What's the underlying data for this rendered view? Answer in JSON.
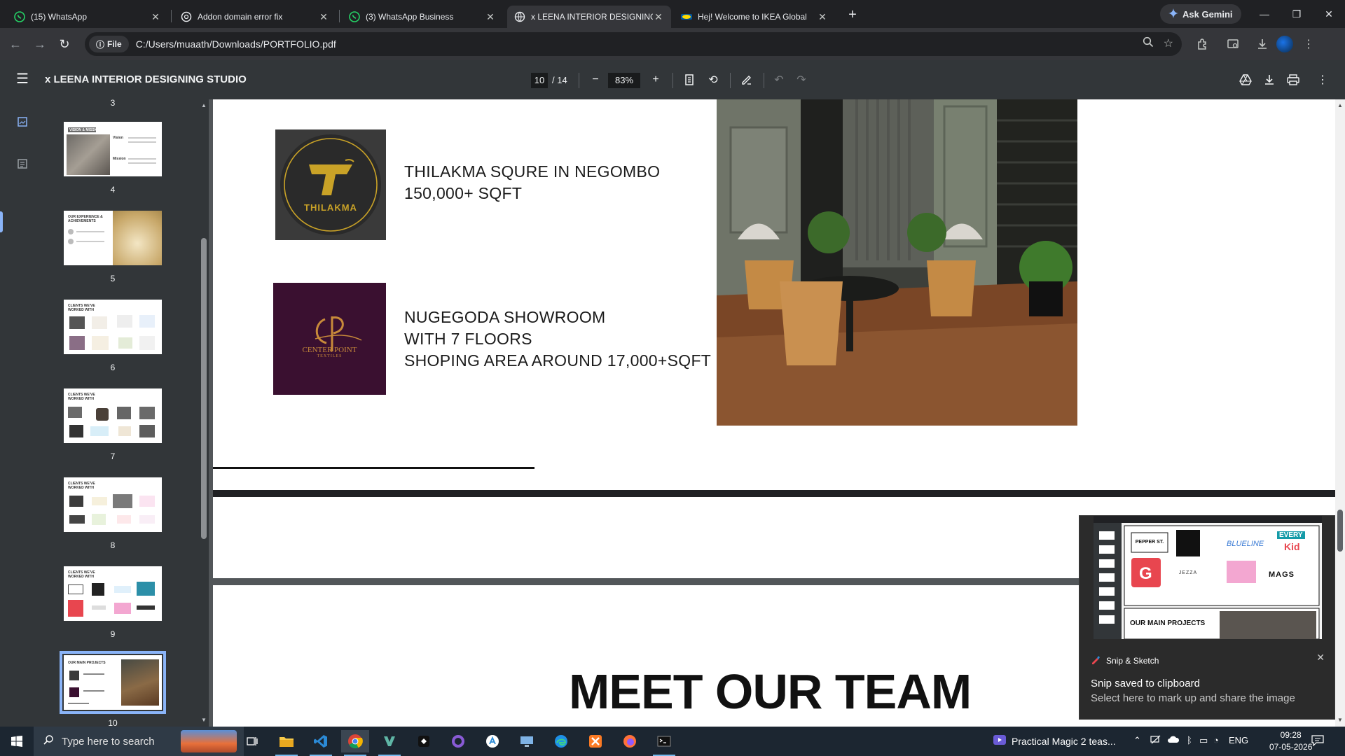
{
  "tabs": [
    {
      "title": "(15) WhatsApp",
      "icon": "whatsapp-icon"
    },
    {
      "title": "Addon domain error fix",
      "icon": "chatgpt-icon"
    },
    {
      "title": "(3) WhatsApp Business",
      "icon": "whatsapp-icon"
    },
    {
      "title": "x LEENA INTERIOR DESIGNING",
      "icon": "globe-icon",
      "active": true
    },
    {
      "title": "Hej! Welcome to IKEA Global",
      "icon": "ikea-icon"
    }
  ],
  "gemini_label": "Ask Gemini",
  "address": {
    "chip": "File",
    "url": "C:/Users/muaath/Downloads/PORTFOLIO.pdf"
  },
  "pdf": {
    "title": "x LEENA INTERIOR DESIGNING STUDIO",
    "page_current": "10",
    "page_total": "/ 14",
    "zoom": "83%"
  },
  "thumbnails": {
    "partial_top_number": "3",
    "pages": [
      {
        "num": "4",
        "heading": "VISION & MISSION",
        "sub": [
          "Vision",
          "Mission"
        ]
      },
      {
        "num": "5",
        "heading": "OUR EXPERIENCE & ACHIEVEMENTS"
      },
      {
        "num": "6",
        "heading": "CLIENTS WE'VE WORKED WITH"
      },
      {
        "num": "7",
        "heading": "CLIENTS WE'VE WORKED WITH"
      },
      {
        "num": "8",
        "heading": "CLIENTS WE'VE WORKED WITH"
      },
      {
        "num": "9",
        "heading": "CLIENTS WE'VE WORKED WITH"
      },
      {
        "num": "10",
        "heading": "OUR MAIN PROJECTS",
        "selected": true
      }
    ]
  },
  "document": {
    "logo1_text": "THILAKMA",
    "logo2_text": "CENTER POINT",
    "logo2_sub": "TEXTILES",
    "project1": [
      "THILAKMA SQURE IN NEGOMBO",
      "150,000+ SQFT"
    ],
    "project2": [
      "NUGEGODA SHOWROOM",
      "WITH 7 FLOORS",
      "SHOPING AREA AROUND 17,000+SQFT"
    ],
    "team_heading": "MEET OUR TEAM"
  },
  "toast": {
    "app": "Snip & Sketch",
    "title": "Snip saved to clipboard",
    "subtitle": "Select here to mark up and share the image",
    "preview": {
      "logos": [
        "PEPPER ST.",
        "BLUELINE",
        "EVERY",
        "Kid",
        "JEZZA",
        "MAGS"
      ],
      "banner": "OUR MAIN PROJECTS"
    }
  },
  "taskbar": {
    "search_placeholder": "Type here to search",
    "media": "Practical Magic 2 teas...",
    "lang": "ENG",
    "time": "09:28",
    "date": "07-05-2026"
  },
  "colors": {
    "accent": "#8ab4f8",
    "logo1_bg": "#3a3a3a",
    "logo1_gold": "#c9a227",
    "logo2_bg": "#3a1030",
    "logo2_gold": "#c88a3a"
  }
}
